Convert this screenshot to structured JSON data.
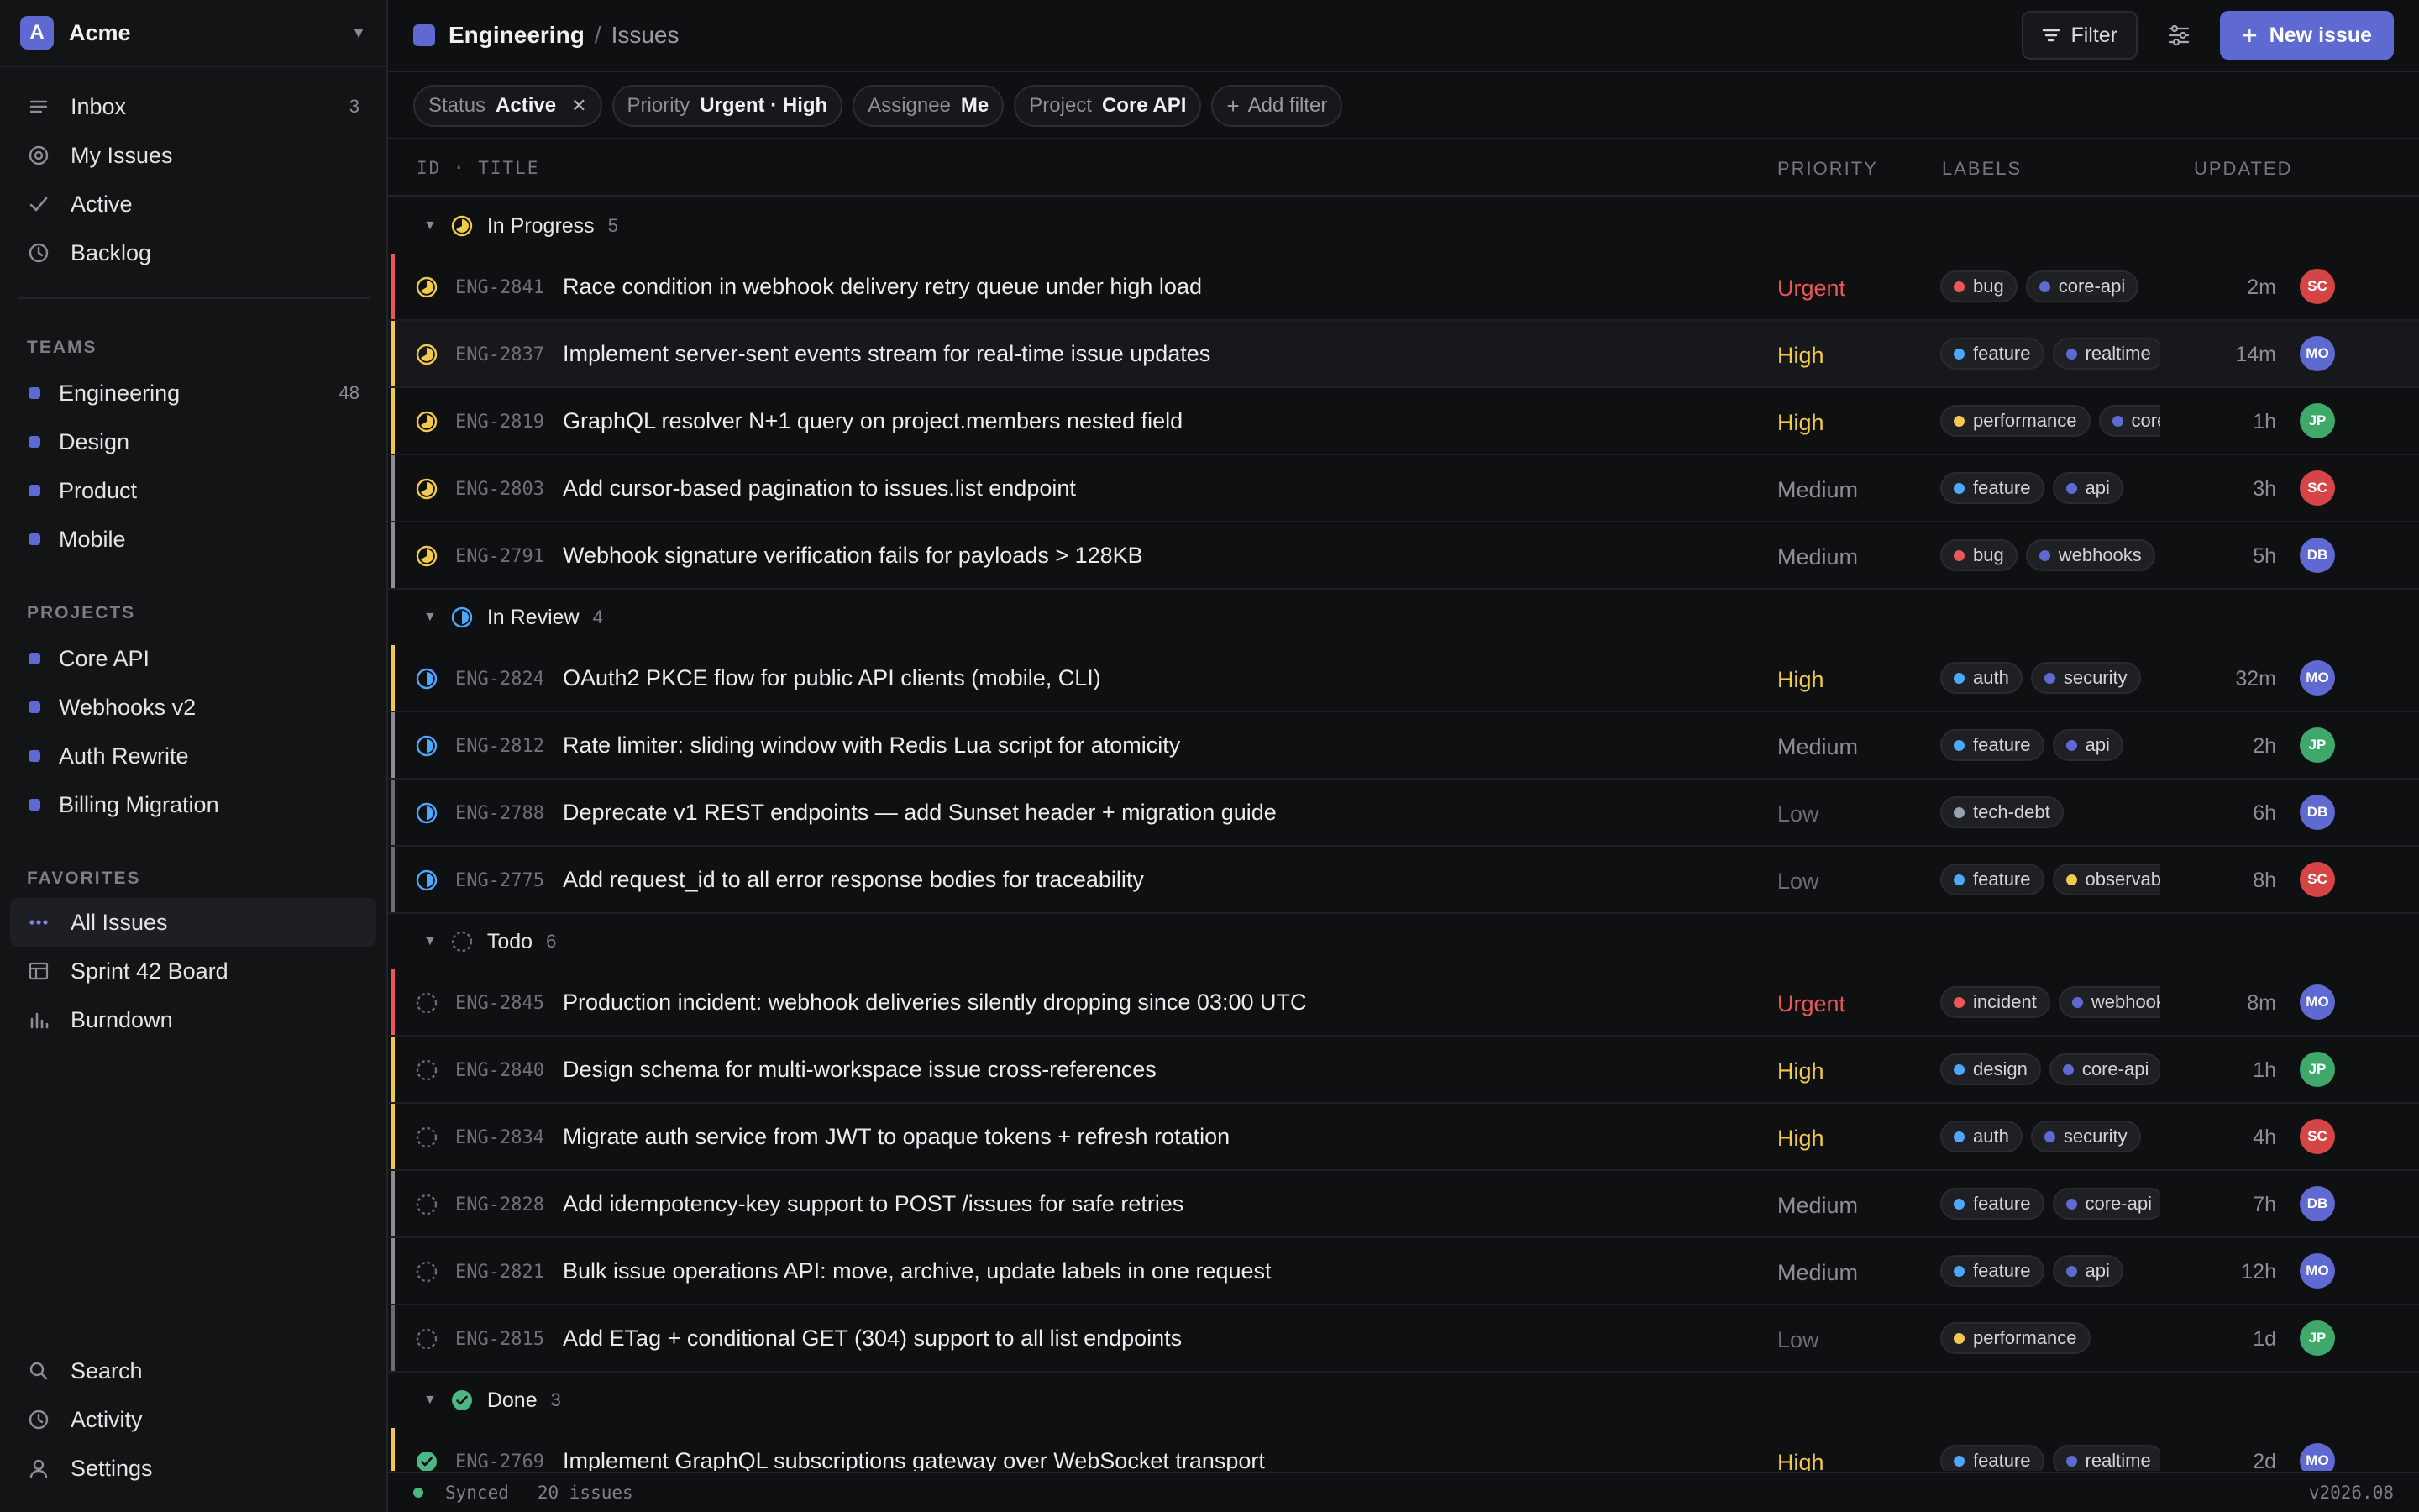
{
  "colors": {
    "accent": "#5e6ad2",
    "urgent": "#eb5757",
    "high": "#f2c94c",
    "medium": "#8d8e94",
    "low": "#6b6c72",
    "in_progress": "#f2c94c",
    "in_review": "#4ea7fc",
    "todo": "#6b6c72",
    "done": "#4cb782"
  },
  "workspace": {
    "initial": "A",
    "name": "Acme"
  },
  "nav": [
    {
      "label": "Inbox",
      "icon": "inbox-icon",
      "count": "3"
    },
    {
      "label": "My Issues",
      "icon": "target-icon",
      "count": ""
    },
    {
      "label": "Active",
      "icon": "check-icon",
      "count": ""
    },
    {
      "label": "Backlog",
      "icon": "clock-icon",
      "count": ""
    }
  ],
  "teams": {
    "title": "TEAMS",
    "items": [
      {
        "label": "Engineering",
        "count": "48"
      },
      {
        "label": "Design",
        "count": ""
      },
      {
        "label": "Product",
        "count": ""
      },
      {
        "label": "Mobile",
        "count": ""
      }
    ]
  },
  "projects": {
    "title": "PROJECTS",
    "items": [
      {
        "label": "Core API"
      },
      {
        "label": "Webhooks v2"
      },
      {
        "label": "Auth Rewrite"
      },
      {
        "label": "Billing Migration"
      }
    ]
  },
  "favorites": {
    "title": "FAVORITES",
    "items": [
      {
        "label": "All Issues",
        "icon": "dots-icon"
      },
      {
        "label": "Sprint 42 Board",
        "icon": "board-icon"
      },
      {
        "label": "Burndown",
        "icon": "chart-icon"
      }
    ]
  },
  "bottom_nav": [
    {
      "label": "Search",
      "icon": "search-icon"
    },
    {
      "label": "Activity",
      "icon": "clock-icon"
    },
    {
      "label": "Settings",
      "icon": "user-icon"
    }
  ],
  "header": {
    "team": "Engineering",
    "separator": "/",
    "page": "Issues",
    "filter_label": "Filter",
    "new_issue_label": "New issue"
  },
  "filters": [
    {
      "key": "Status",
      "value": "Active",
      "removable": true
    },
    {
      "key": "Priority",
      "value": "Urgent · High",
      "removable": false
    },
    {
      "key": "Assignee",
      "value": "Me",
      "removable": false
    },
    {
      "key": "Project",
      "value": "Core API",
      "removable": false
    }
  ],
  "add_filter_label": "Add filter",
  "columns": {
    "id_title": "ID · TITLE",
    "priority": "PRIORITY",
    "labels": "LABELS",
    "updated": "UPDATED"
  },
  "label_colors": {
    "bug": "#eb5757",
    "core-api": "#5e6ad2",
    "feature": "#4ea7fc",
    "realtime": "#5e6ad2",
    "performance": "#f2c94c",
    "api": "#5e6ad2",
    "webhooks": "#5e6ad2",
    "auth": "#4ea7fc",
    "security": "#5e6ad2",
    "tech-debt": "#95a2b3",
    "observability": "#f2c94c",
    "incident": "#eb5757",
    "design": "#4ea7fc"
  },
  "avatar_colors": {
    "SC": "#d64545",
    "MO": "#5e6ad2",
    "JP": "#3fa96b",
    "DB": "#5e6ad2"
  },
  "groups": [
    {
      "name": "In Progress",
      "count": "5",
      "status": "in_progress",
      "issues": [
        {
          "id": "ENG-2841",
          "title": "Race condition in webhook delivery retry queue under high load",
          "priority": "Urgent",
          "labels": [
            "bug",
            "core-api"
          ],
          "updated": "2m",
          "assignee": "SC"
        },
        {
          "id": "ENG-2837",
          "title": "Implement server-sent events stream for real-time issue updates",
          "priority": "High",
          "labels": [
            "feature",
            "realtime"
          ],
          "updated": "14m",
          "assignee": "MO",
          "highlight": true
        },
        {
          "id": "ENG-2819",
          "title": "GraphQL resolver N+1 query on project.members nested field",
          "priority": "High",
          "labels": [
            "performance",
            "core-api"
          ],
          "updated": "1h",
          "assignee": "JP"
        },
        {
          "id": "ENG-2803",
          "title": "Add cursor-based pagination to issues.list endpoint",
          "priority": "Medium",
          "labels": [
            "feature",
            "api"
          ],
          "updated": "3h",
          "assignee": "SC"
        },
        {
          "id": "ENG-2791",
          "title": "Webhook signature verification fails for payloads > 128KB",
          "priority": "Medium",
          "labels": [
            "bug",
            "webhooks"
          ],
          "updated": "5h",
          "assignee": "DB"
        }
      ]
    },
    {
      "name": "In Review",
      "count": "4",
      "status": "in_review",
      "issues": [
        {
          "id": "ENG-2824",
          "title": "OAuth2 PKCE flow for public API clients (mobile, CLI)",
          "priority": "High",
          "labels": [
            "auth",
            "security"
          ],
          "updated": "32m",
          "assignee": "MO"
        },
        {
          "id": "ENG-2812",
          "title": "Rate limiter: sliding window with Redis Lua script for atomicity",
          "priority": "Medium",
          "labels": [
            "feature",
            "api"
          ],
          "updated": "2h",
          "assignee": "JP"
        },
        {
          "id": "ENG-2788",
          "title": "Deprecate v1 REST endpoints — add Sunset header + migration guide",
          "priority": "Low",
          "labels": [
            "tech-debt"
          ],
          "updated": "6h",
          "assignee": "DB"
        },
        {
          "id": "ENG-2775",
          "title": "Add request_id to all error response bodies for traceability",
          "priority": "Low",
          "labels": [
            "feature",
            "observability"
          ],
          "updated": "8h",
          "assignee": "SC"
        }
      ]
    },
    {
      "name": "Todo",
      "count": "6",
      "status": "todo",
      "issues": [
        {
          "id": "ENG-2845",
          "title": "Production incident: webhook deliveries silently dropping since 03:00 UTC",
          "priority": "Urgent",
          "labels": [
            "incident",
            "webhooks"
          ],
          "updated": "8m",
          "assignee": "MO"
        },
        {
          "id": "ENG-2840",
          "title": "Design schema for multi-workspace issue cross-references",
          "priority": "High",
          "labels": [
            "design",
            "core-api"
          ],
          "updated": "1h",
          "assignee": "JP"
        },
        {
          "id": "ENG-2834",
          "title": "Migrate auth service from JWT to opaque tokens + refresh rotation",
          "priority": "High",
          "labels": [
            "auth",
            "security"
          ],
          "updated": "4h",
          "assignee": "SC"
        },
        {
          "id": "ENG-2828",
          "title": "Add idempotency-key support to POST /issues for safe retries",
          "priority": "Medium",
          "labels": [
            "feature",
            "core-api"
          ],
          "updated": "7h",
          "assignee": "DB"
        },
        {
          "id": "ENG-2821",
          "title": "Bulk issue operations API: move, archive, update labels in one request",
          "priority": "Medium",
          "labels": [
            "feature",
            "api"
          ],
          "updated": "12h",
          "assignee": "MO"
        },
        {
          "id": "ENG-2815",
          "title": "Add ETag + conditional GET (304) support to all list endpoints",
          "priority": "Low",
          "labels": [
            "performance"
          ],
          "updated": "1d",
          "assignee": "JP"
        }
      ]
    },
    {
      "name": "Done",
      "count": "3",
      "status": "done",
      "issues": [
        {
          "id": "ENG-2769",
          "title": "Implement GraphQL subscriptions gateway over WebSocket transport",
          "priority": "High",
          "labels": [
            "feature",
            "realtime"
          ],
          "updated": "2d",
          "assignee": "MO"
        }
      ]
    }
  ],
  "statusbar": {
    "sync": "Synced",
    "count": "20 issues",
    "version": "v2026.08"
  }
}
